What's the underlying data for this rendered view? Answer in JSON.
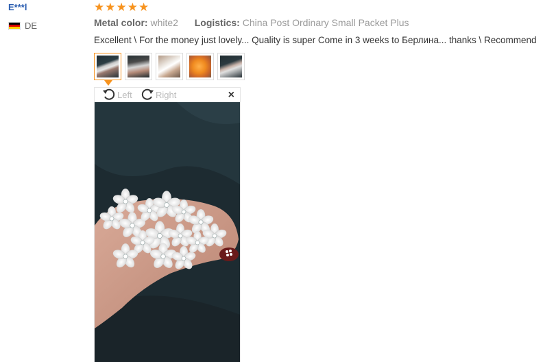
{
  "reviewer": {
    "name": "E***l",
    "country": "DE"
  },
  "rating": {
    "stars": 5,
    "max": 5
  },
  "meta": {
    "color_label": "Metal color:",
    "color_value": "white2",
    "logistics_label": "Logistics:",
    "logistics_value": "China Post Ordinary Small Packet Plus"
  },
  "review": {
    "text": "Excellent \\ For the money just lovely... Quality is super Come in 3 weeks to Берлина... thanks \\ Recommend"
  },
  "photos": {
    "count": 5,
    "active_index": 0
  },
  "viewer": {
    "rotate_left_label": "Left",
    "rotate_right_label": "Right",
    "close_symbol": "×"
  },
  "colors": {
    "accent": "#f7931e",
    "link": "#2a5db0"
  }
}
